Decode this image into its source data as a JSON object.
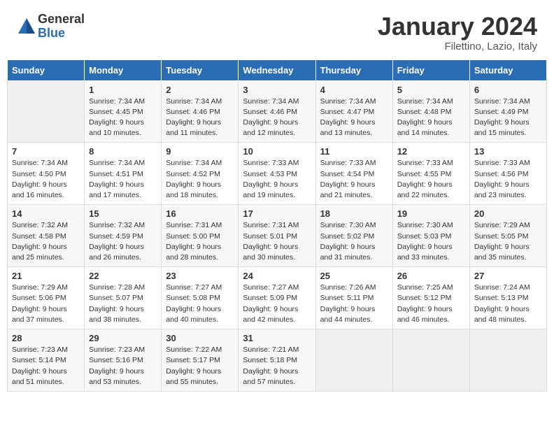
{
  "header": {
    "logo_general": "General",
    "logo_blue": "Blue",
    "month_title": "January 2024",
    "subtitle": "Filettino, Lazio, Italy"
  },
  "days_of_week": [
    "Sunday",
    "Monday",
    "Tuesday",
    "Wednesday",
    "Thursday",
    "Friday",
    "Saturday"
  ],
  "weeks": [
    [
      {
        "day": "",
        "info": ""
      },
      {
        "day": "1",
        "info": "Sunrise: 7:34 AM\nSunset: 4:45 PM\nDaylight: 9 hours\nand 10 minutes."
      },
      {
        "day": "2",
        "info": "Sunrise: 7:34 AM\nSunset: 4:46 PM\nDaylight: 9 hours\nand 11 minutes."
      },
      {
        "day": "3",
        "info": "Sunrise: 7:34 AM\nSunset: 4:46 PM\nDaylight: 9 hours\nand 12 minutes."
      },
      {
        "day": "4",
        "info": "Sunrise: 7:34 AM\nSunset: 4:47 PM\nDaylight: 9 hours\nand 13 minutes."
      },
      {
        "day": "5",
        "info": "Sunrise: 7:34 AM\nSunset: 4:48 PM\nDaylight: 9 hours\nand 14 minutes."
      },
      {
        "day": "6",
        "info": "Sunrise: 7:34 AM\nSunset: 4:49 PM\nDaylight: 9 hours\nand 15 minutes."
      }
    ],
    [
      {
        "day": "7",
        "info": "Sunrise: 7:34 AM\nSunset: 4:50 PM\nDaylight: 9 hours\nand 16 minutes."
      },
      {
        "day": "8",
        "info": "Sunrise: 7:34 AM\nSunset: 4:51 PM\nDaylight: 9 hours\nand 17 minutes."
      },
      {
        "day": "9",
        "info": "Sunrise: 7:34 AM\nSunset: 4:52 PM\nDaylight: 9 hours\nand 18 minutes."
      },
      {
        "day": "10",
        "info": "Sunrise: 7:33 AM\nSunset: 4:53 PM\nDaylight: 9 hours\nand 19 minutes."
      },
      {
        "day": "11",
        "info": "Sunrise: 7:33 AM\nSunset: 4:54 PM\nDaylight: 9 hours\nand 21 minutes."
      },
      {
        "day": "12",
        "info": "Sunrise: 7:33 AM\nSunset: 4:55 PM\nDaylight: 9 hours\nand 22 minutes."
      },
      {
        "day": "13",
        "info": "Sunrise: 7:33 AM\nSunset: 4:56 PM\nDaylight: 9 hours\nand 23 minutes."
      }
    ],
    [
      {
        "day": "14",
        "info": "Sunrise: 7:32 AM\nSunset: 4:58 PM\nDaylight: 9 hours\nand 25 minutes."
      },
      {
        "day": "15",
        "info": "Sunrise: 7:32 AM\nSunset: 4:59 PM\nDaylight: 9 hours\nand 26 minutes."
      },
      {
        "day": "16",
        "info": "Sunrise: 7:31 AM\nSunset: 5:00 PM\nDaylight: 9 hours\nand 28 minutes."
      },
      {
        "day": "17",
        "info": "Sunrise: 7:31 AM\nSunset: 5:01 PM\nDaylight: 9 hours\nand 30 minutes."
      },
      {
        "day": "18",
        "info": "Sunrise: 7:30 AM\nSunset: 5:02 PM\nDaylight: 9 hours\nand 31 minutes."
      },
      {
        "day": "19",
        "info": "Sunrise: 7:30 AM\nSunset: 5:03 PM\nDaylight: 9 hours\nand 33 minutes."
      },
      {
        "day": "20",
        "info": "Sunrise: 7:29 AM\nSunset: 5:05 PM\nDaylight: 9 hours\nand 35 minutes."
      }
    ],
    [
      {
        "day": "21",
        "info": "Sunrise: 7:29 AM\nSunset: 5:06 PM\nDaylight: 9 hours\nand 37 minutes."
      },
      {
        "day": "22",
        "info": "Sunrise: 7:28 AM\nSunset: 5:07 PM\nDaylight: 9 hours\nand 38 minutes."
      },
      {
        "day": "23",
        "info": "Sunrise: 7:27 AM\nSunset: 5:08 PM\nDaylight: 9 hours\nand 40 minutes."
      },
      {
        "day": "24",
        "info": "Sunrise: 7:27 AM\nSunset: 5:09 PM\nDaylight: 9 hours\nand 42 minutes."
      },
      {
        "day": "25",
        "info": "Sunrise: 7:26 AM\nSunset: 5:11 PM\nDaylight: 9 hours\nand 44 minutes."
      },
      {
        "day": "26",
        "info": "Sunrise: 7:25 AM\nSunset: 5:12 PM\nDaylight: 9 hours\nand 46 minutes."
      },
      {
        "day": "27",
        "info": "Sunrise: 7:24 AM\nSunset: 5:13 PM\nDaylight: 9 hours\nand 48 minutes."
      }
    ],
    [
      {
        "day": "28",
        "info": "Sunrise: 7:23 AM\nSunset: 5:14 PM\nDaylight: 9 hours\nand 51 minutes."
      },
      {
        "day": "29",
        "info": "Sunrise: 7:23 AM\nSunset: 5:16 PM\nDaylight: 9 hours\nand 53 minutes."
      },
      {
        "day": "30",
        "info": "Sunrise: 7:22 AM\nSunset: 5:17 PM\nDaylight: 9 hours\nand 55 minutes."
      },
      {
        "day": "31",
        "info": "Sunrise: 7:21 AM\nSunset: 5:18 PM\nDaylight: 9 hours\nand 57 minutes."
      },
      {
        "day": "",
        "info": ""
      },
      {
        "day": "",
        "info": ""
      },
      {
        "day": "",
        "info": ""
      }
    ]
  ]
}
